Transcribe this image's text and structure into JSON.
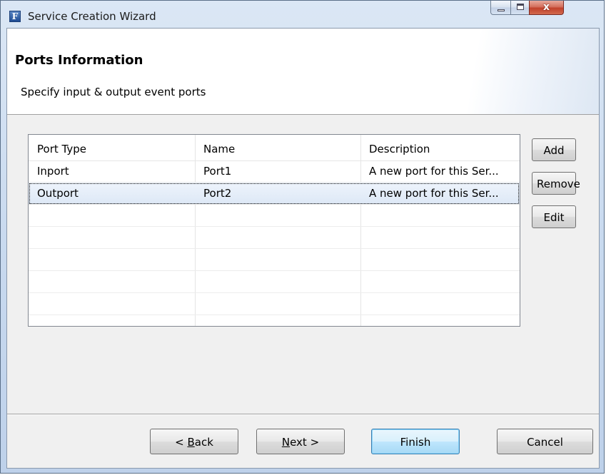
{
  "window": {
    "app_icon_letter": "F",
    "title": "Service Creation Wizard",
    "close_glyph": "x"
  },
  "header": {
    "title": "Ports Information",
    "subtitle": "Specify input & output event ports"
  },
  "ports_table": {
    "columns": [
      "Port Type",
      "Name",
      "Description"
    ],
    "rows": [
      {
        "port_type": "Inport",
        "name": "Port1",
        "description": "A new port for this Ser..."
      },
      {
        "port_type": "Outport",
        "name": "Port2",
        "description": "A new port for this Ser..."
      }
    ],
    "selected_row": 1
  },
  "side_buttons": {
    "add": "Add",
    "remove": "Remove",
    "edit": "Edit"
  },
  "footer": {
    "back_prefix": "< ",
    "back_mnemonic": "B",
    "back_rest": "ack",
    "next_mnemonic": "N",
    "next_rest": "ext >",
    "finish": "Finish",
    "cancel": "Cancel"
  },
  "colors": {
    "selection": "#dde8f6",
    "default_button_border": "#3c7fb1",
    "close_button": "#c1412b"
  },
  "icons": [
    "app-icon",
    "minimize-icon",
    "maximize-icon",
    "close-icon"
  ]
}
